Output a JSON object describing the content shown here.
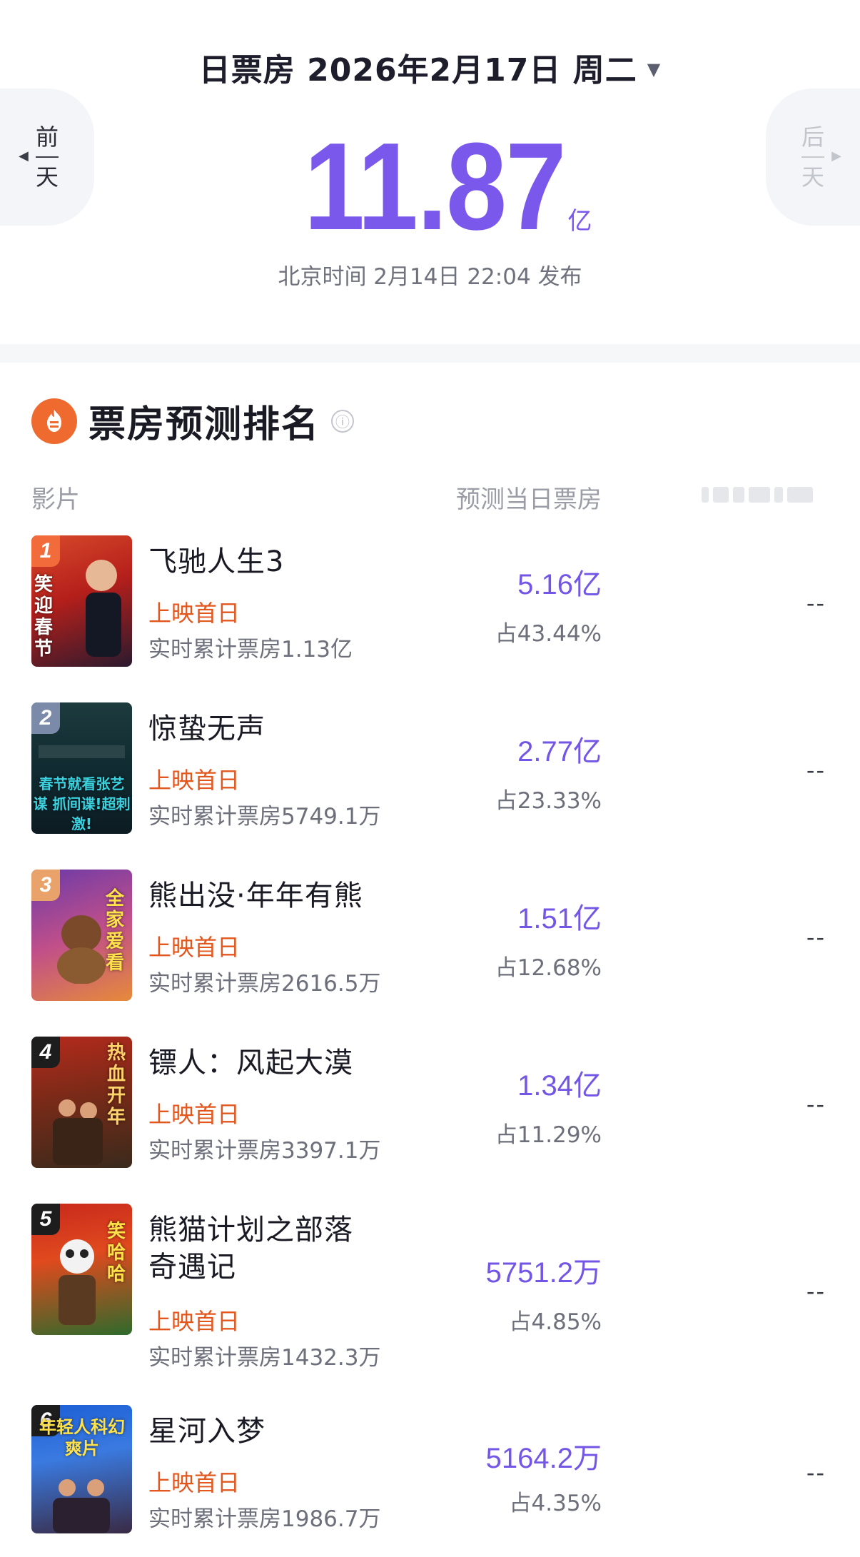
{
  "header": {
    "date_label": "日票房 2026年2月17日 周二",
    "caret": "▼",
    "prev": {
      "chars": [
        "前",
        "天"
      ],
      "arrow": "◀"
    },
    "next": {
      "chars": [
        "后",
        "天"
      ],
      "arrow": "▶"
    },
    "total_value": "11.87",
    "total_unit": "亿",
    "publish_time": "北京时间 2月14日 22:04 发布"
  },
  "ranking": {
    "title": "票房预测排名",
    "info_icon": "ⓘ",
    "col_film": "影片",
    "col_forecast": "预测当日票房",
    "movies": [
      {
        "rank": "1",
        "title": "飞驰人生3",
        "status": "上映首日",
        "cume": "实时累计票房1.13亿",
        "forecast": "5.16亿",
        "share": "占43.44%",
        "extra": "--",
        "poster_text": "笑迎春节"
      },
      {
        "rank": "2",
        "title": "惊蛰无声",
        "status": "上映首日",
        "cume": "实时累计票房5749.1万",
        "forecast": "2.77亿",
        "share": "占23.33%",
        "extra": "--",
        "poster_text": "春节就看张艺谋 抓间谍!超刺激!"
      },
      {
        "rank": "3",
        "title": "熊出没·年年有熊",
        "status": "上映首日",
        "cume": "实时累计票房2616.5万",
        "forecast": "1.51亿",
        "share": "占12.68%",
        "extra": "--",
        "poster_text": "全家爱看"
      },
      {
        "rank": "4",
        "title": "镖人：风起大漠",
        "status": "上映首日",
        "cume": "实时累计票房3397.1万",
        "forecast": "1.34亿",
        "share": "占11.29%",
        "extra": "--",
        "poster_text": "热血开年"
      },
      {
        "rank": "5",
        "title_lines": [
          "熊猫计划之部落",
          "奇遇记"
        ],
        "status": "上映首日",
        "cume": "实时累计票房1432.3万",
        "forecast": "5751.2万",
        "share": "占4.85%",
        "extra": "--",
        "poster_text": "笑哈哈"
      },
      {
        "rank": "6",
        "title": "星河入梦",
        "status": "上映首日",
        "cume": "实时累计票房1986.7万",
        "forecast": "5164.2万",
        "share": "占4.35%",
        "extra": "--",
        "poster_text": "年轻人科幻爽片"
      }
    ]
  },
  "colors": {
    "accent": "#7a58ec",
    "status": "#e2571e",
    "fire_icon": "#ee6a2e"
  }
}
